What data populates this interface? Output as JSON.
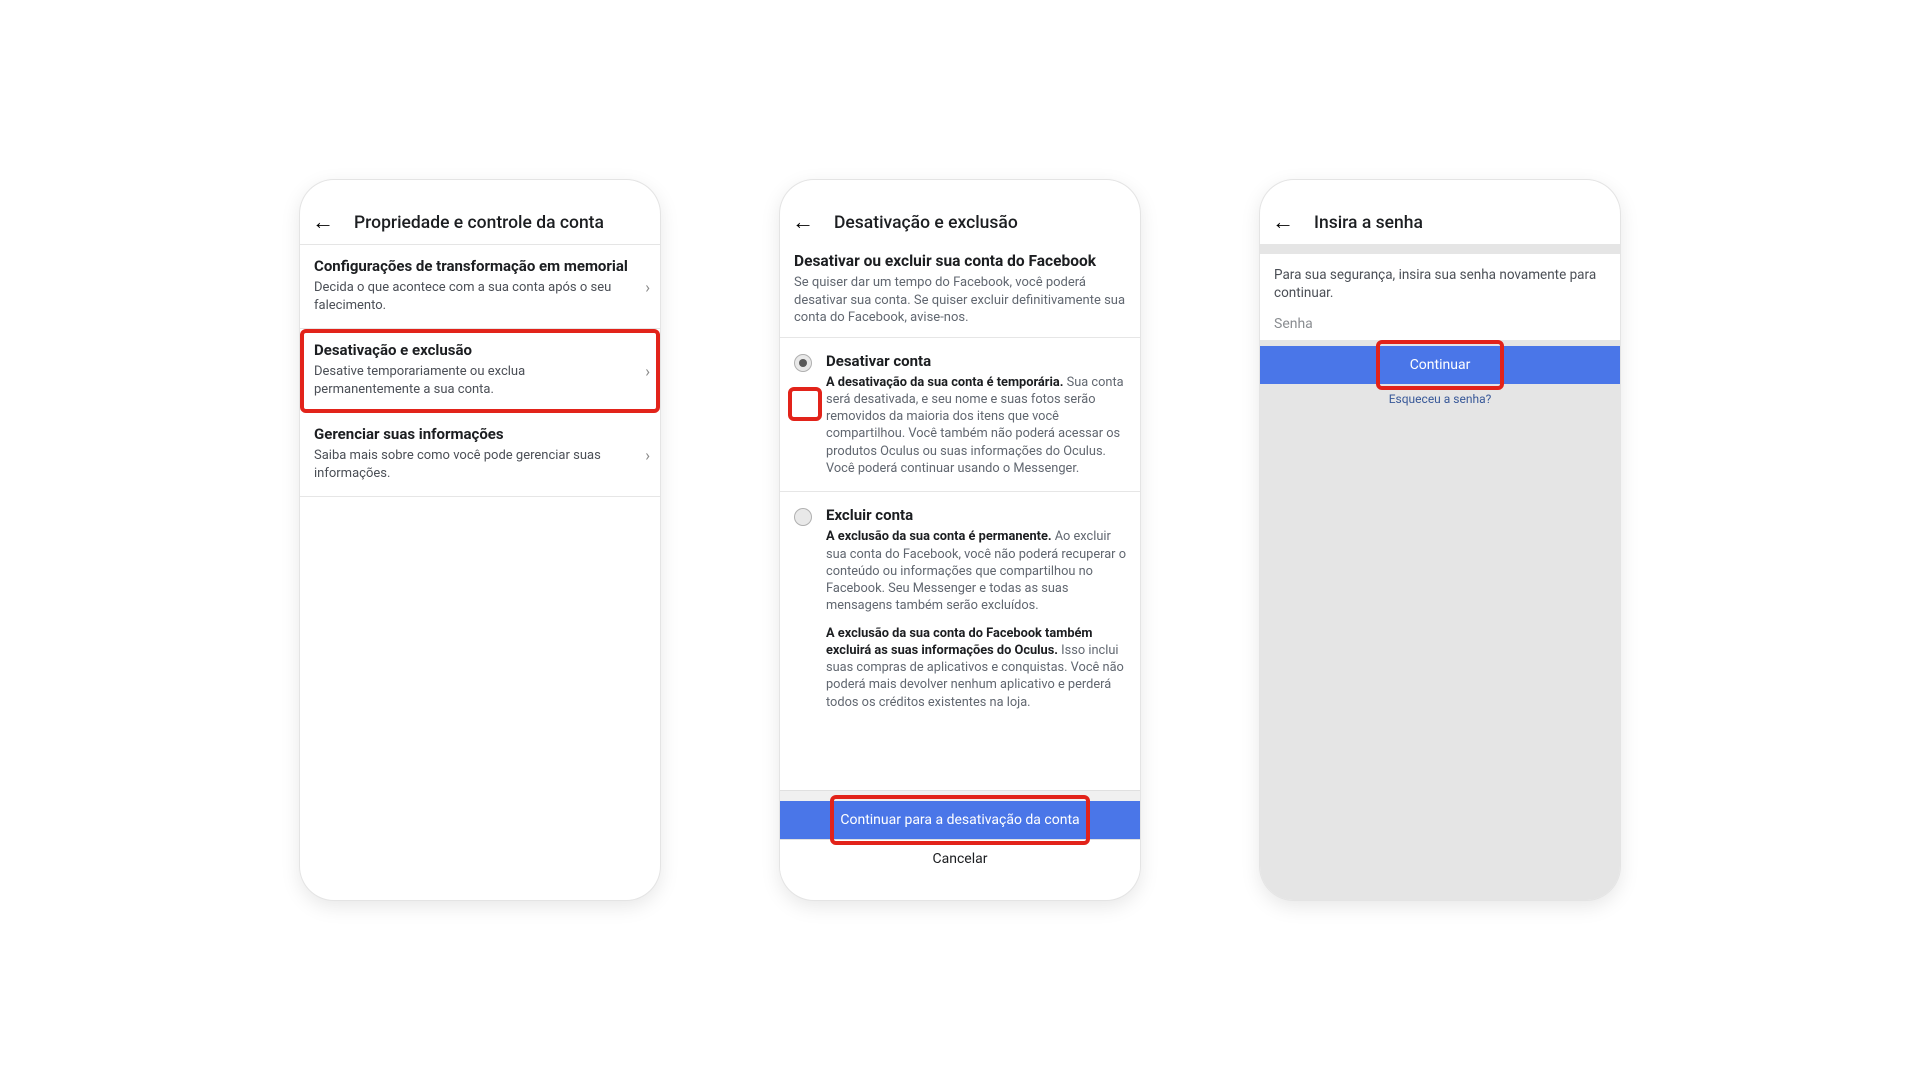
{
  "screen1": {
    "header_title": "Propriedade e controle da conta",
    "items": [
      {
        "title": "Configurações de transformação em memorial",
        "desc": "Decida o que acontece com a sua conta após o seu falecimento."
      },
      {
        "title": "Desativação e exclusão",
        "desc": "Desative temporariamente ou exclua permanentemente a sua conta."
      },
      {
        "title": "Gerenciar suas informações",
        "desc": "Saiba mais sobre como você pode gerenciar suas informações."
      }
    ]
  },
  "screen2": {
    "header_title": "Desativação e exclusão",
    "section_title": "Desativar ou excluir sua conta do Facebook",
    "section_desc": "Se quiser dar um tempo do Facebook, você poderá desativar sua conta. Se quiser excluir definitivamente sua conta do Facebook, avise-nos.",
    "options": [
      {
        "title": "Desativar conta",
        "bold": "A desativação da sua conta é temporária.",
        "rest": " Sua conta será desativada, e seu nome e suas fotos serão removidos da maioria dos itens que você compartilhou. Você também não poderá acessar os produtos Oculus ou suas informações do Oculus. Você poderá continuar usando o Messenger.",
        "selected": true
      },
      {
        "title": "Excluir conta",
        "bold": "A exclusão da sua conta é permanente.",
        "rest": " Ao excluir sua conta do Facebook, você não poderá recuperar o conteúdo ou informações que compartilhou no Facebook. Seu Messenger e todas as suas mensagens também serão excluídos.",
        "bold2": "A exclusão da sua conta do Facebook também excluirá as suas informações do Oculus.",
        "rest2": " Isso inclui suas compras de aplicativos e conquistas. Você não poderá mais devolver nenhum aplicativo e perderá todos os créditos existentes na loja.",
        "selected": false
      }
    ],
    "primary_btn": "Continuar para a desativação da conta",
    "secondary_btn": "Cancelar"
  },
  "screen3": {
    "header_title": "Insira a senha",
    "message": "Para sua segurança, insira sua senha novamente para continuar.",
    "password_placeholder": "Senha",
    "primary_btn": "Continuar",
    "forgot_link": "Esqueceu a senha?"
  }
}
